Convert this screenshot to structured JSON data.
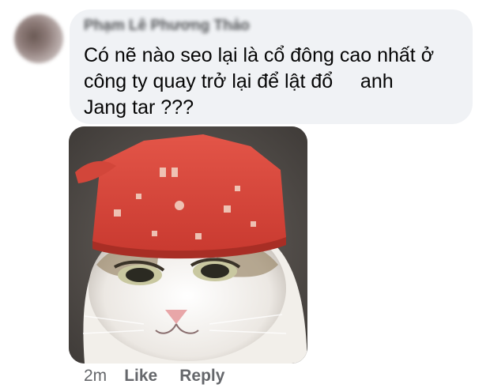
{
  "comment": {
    "author": "Phạm Lê Phương Thảo",
    "text_lines": [
      "Có nẽ nào seo lại là cổ đông cao nhất ở",
      "công ty quay trở lại để lật đổ     anh",
      "Jang tar ???"
    ],
    "attachment_icon": "cat-with-red-bandana-image",
    "time": "2m",
    "like_label": "Like",
    "reply_label": "Reply"
  },
  "colors": {
    "bubble_bg": "#f0f2f5",
    "meta_text": "#65676b",
    "body_text": "#050505"
  }
}
